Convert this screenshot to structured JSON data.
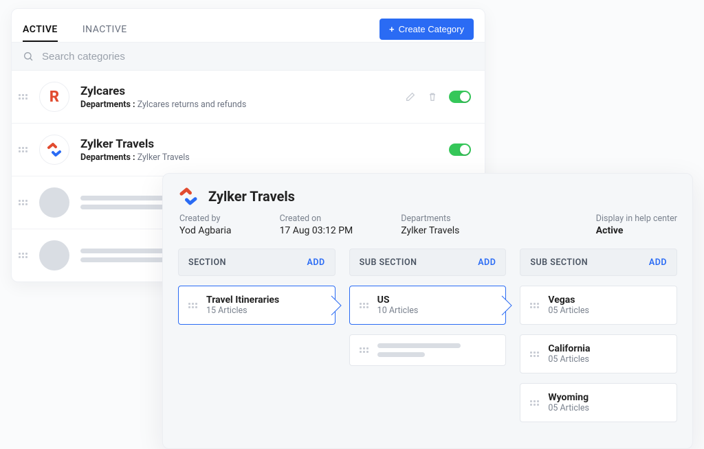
{
  "tabs": {
    "active": "ACTIVE",
    "inactive": "INACTIVE"
  },
  "create_button": "Create Category",
  "search_placeholder": "Search categories",
  "dept_label": "Departments :",
  "categories": [
    {
      "name": "Zylcares",
      "departments": "Zylcares returns and refunds",
      "letter": "R"
    },
    {
      "name": "Zylker Travels",
      "departments": "Zylker Travels"
    }
  ],
  "detail": {
    "title": "Zylker Travels",
    "meta": {
      "created_by_label": "Created by",
      "created_by": "Yod Agbaria",
      "created_on_label": "Created on",
      "created_on": "17 Aug 03:12 PM",
      "departments_label": "Departments",
      "departments": "Zylker Travels",
      "display_label": "Display in help center",
      "display_value": "Active"
    },
    "col1": {
      "header": "SECTION",
      "add": "ADD",
      "items": [
        {
          "title": "Travel Itineraries",
          "sub": "15 Articles"
        }
      ]
    },
    "col2": {
      "header": "SUB SECTION",
      "add": "ADD",
      "items": [
        {
          "title": "US",
          "sub": "10 Articles"
        }
      ]
    },
    "col3": {
      "header": "SUB SECTION",
      "add": "ADD",
      "items": [
        {
          "title": "Vegas",
          "sub": "05 Articles"
        },
        {
          "title": "California",
          "sub": "05 Articles"
        },
        {
          "title": "Wyoming",
          "sub": "05 Articles"
        }
      ]
    }
  }
}
